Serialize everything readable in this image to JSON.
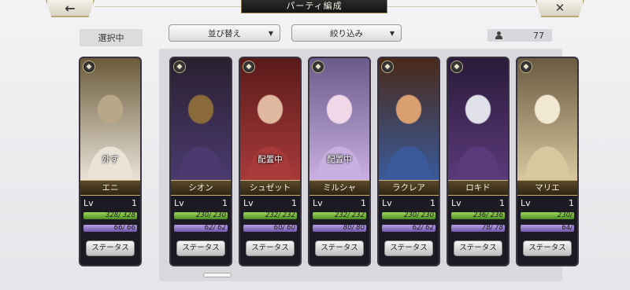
{
  "header": {
    "title": "パーティ編成",
    "back_icon": "←",
    "close_icon": "✕"
  },
  "toolbar": {
    "sort_label": "並び替え",
    "filter_label": "絞り込み",
    "caret": "▼",
    "count": "77"
  },
  "selected_label": "選択中",
  "status_label": "ステータス",
  "lv_label": "Lv",
  "colors": {
    "hp": "#7ec04a",
    "mp": "#9b86d1",
    "plate": "#4a3b20"
  },
  "characters": [
    {
      "name": "エニ",
      "lv": "1",
      "hp": "328/ 328",
      "mp": "66/  66",
      "state": "外す",
      "class_icon": "magic-orb-icon",
      "portrait": [
        "#e9e3d8",
        "#b8a888",
        "#6b5b3a"
      ]
    },
    {
      "name": "シオン",
      "lv": "1",
      "hp": "230/ 230",
      "mp": "62/  62",
      "state": "",
      "class_icon": "sword-icon",
      "portrait": [
        "#4a3a6e",
        "#8a6a3a",
        "#2a2030"
      ]
    },
    {
      "name": "シュゼット",
      "lv": "1",
      "hp": "232/ 232",
      "mp": "60/  60",
      "state": "配置中",
      "class_icon": "bow-icon",
      "portrait": [
        "#a83a3a",
        "#e0b8a0",
        "#5a1a1a"
      ]
    },
    {
      "name": "ミルシャ",
      "lv": "1",
      "hp": "232/ 232",
      "mp": "80/  80",
      "state": "配置中",
      "class_icon": "bow-icon",
      "portrait": [
        "#c8b0e0",
        "#f0d8e8",
        "#6a5a8a"
      ]
    },
    {
      "name": "ラクレア",
      "lv": "1",
      "hp": "230/ 230",
      "mp": "62/  62",
      "state": "",
      "class_icon": "shield-icon",
      "portrait": [
        "#3a5a9a",
        "#d8a070",
        "#4a2a1a"
      ]
    },
    {
      "name": "ロキド",
      "lv": "1",
      "hp": "236/ 236",
      "mp": "78/  78",
      "state": "",
      "class_icon": "axe-icon",
      "portrait": [
        "#5a3a7a",
        "#e0e0e8",
        "#2a1a3a"
      ]
    },
    {
      "name": "マリエ",
      "lv": "1",
      "hp": "230/",
      "mp": "64/",
      "state": "",
      "class_icon": "staff-icon",
      "portrait": [
        "#d8c8a0",
        "#f0e8d0",
        "#6a5a40"
      ]
    }
  ]
}
